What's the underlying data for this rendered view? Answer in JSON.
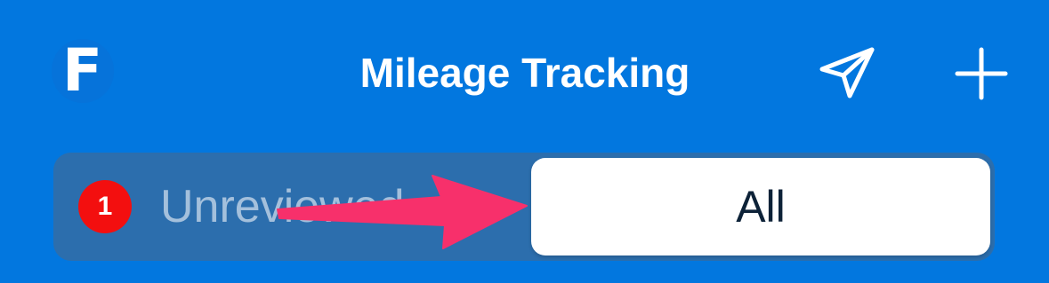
{
  "header": {
    "logo_text": "F",
    "title": "Mileage Tracking",
    "send_icon": "paper-plane-icon",
    "add_icon": "plus-icon"
  },
  "segmented_control": {
    "badge_count": "1",
    "left_label": "Unreviewed",
    "right_label": "All",
    "selected": "All"
  },
  "colors": {
    "header_bg": "#0277df",
    "segment_track": "#2c6ead",
    "badge": "#f30f0f",
    "selected_bg": "#ffffff",
    "annotation_arrow": "#f7306b"
  }
}
